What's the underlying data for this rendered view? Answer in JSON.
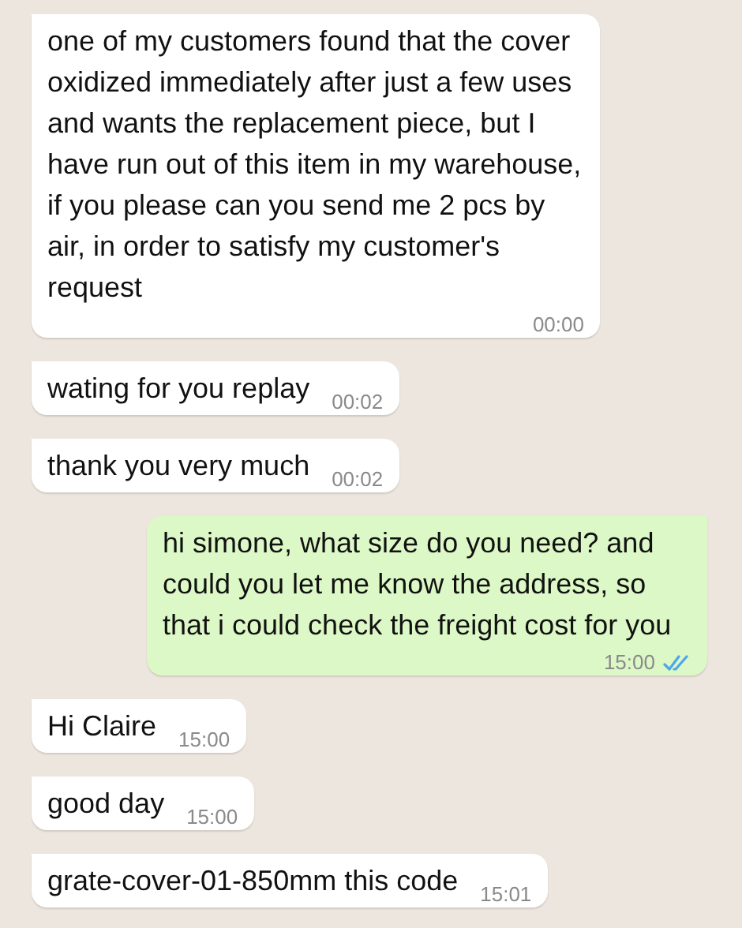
{
  "messages": [
    {
      "kind": "incoming",
      "text": "one of my customers found that the cover oxidized immediately after just a few uses and wants the replacement piece, but I have run out of this item in my warehouse, if you please can you send me 2 pcs by air, in order to satisfy my customer's request",
      "time": "00:00"
    },
    {
      "kind": "incoming",
      "text": "wating for you replay",
      "time": "00:02"
    },
    {
      "kind": "incoming",
      "text": "thank you very much",
      "time": "00:02"
    },
    {
      "kind": "outgoing",
      "text": "hi simone, what size do you need? and could you let me know the address, so that i could check the freight cost for you",
      "time": "15:00",
      "read": true
    },
    {
      "kind": "incoming",
      "text": "Hi Claire",
      "time": "15:00"
    },
    {
      "kind": "incoming",
      "text": "good day",
      "time": "15:00"
    },
    {
      "kind": "incoming",
      "text": "grate-cover-01-850mm this code",
      "time": "15:01"
    }
  ]
}
